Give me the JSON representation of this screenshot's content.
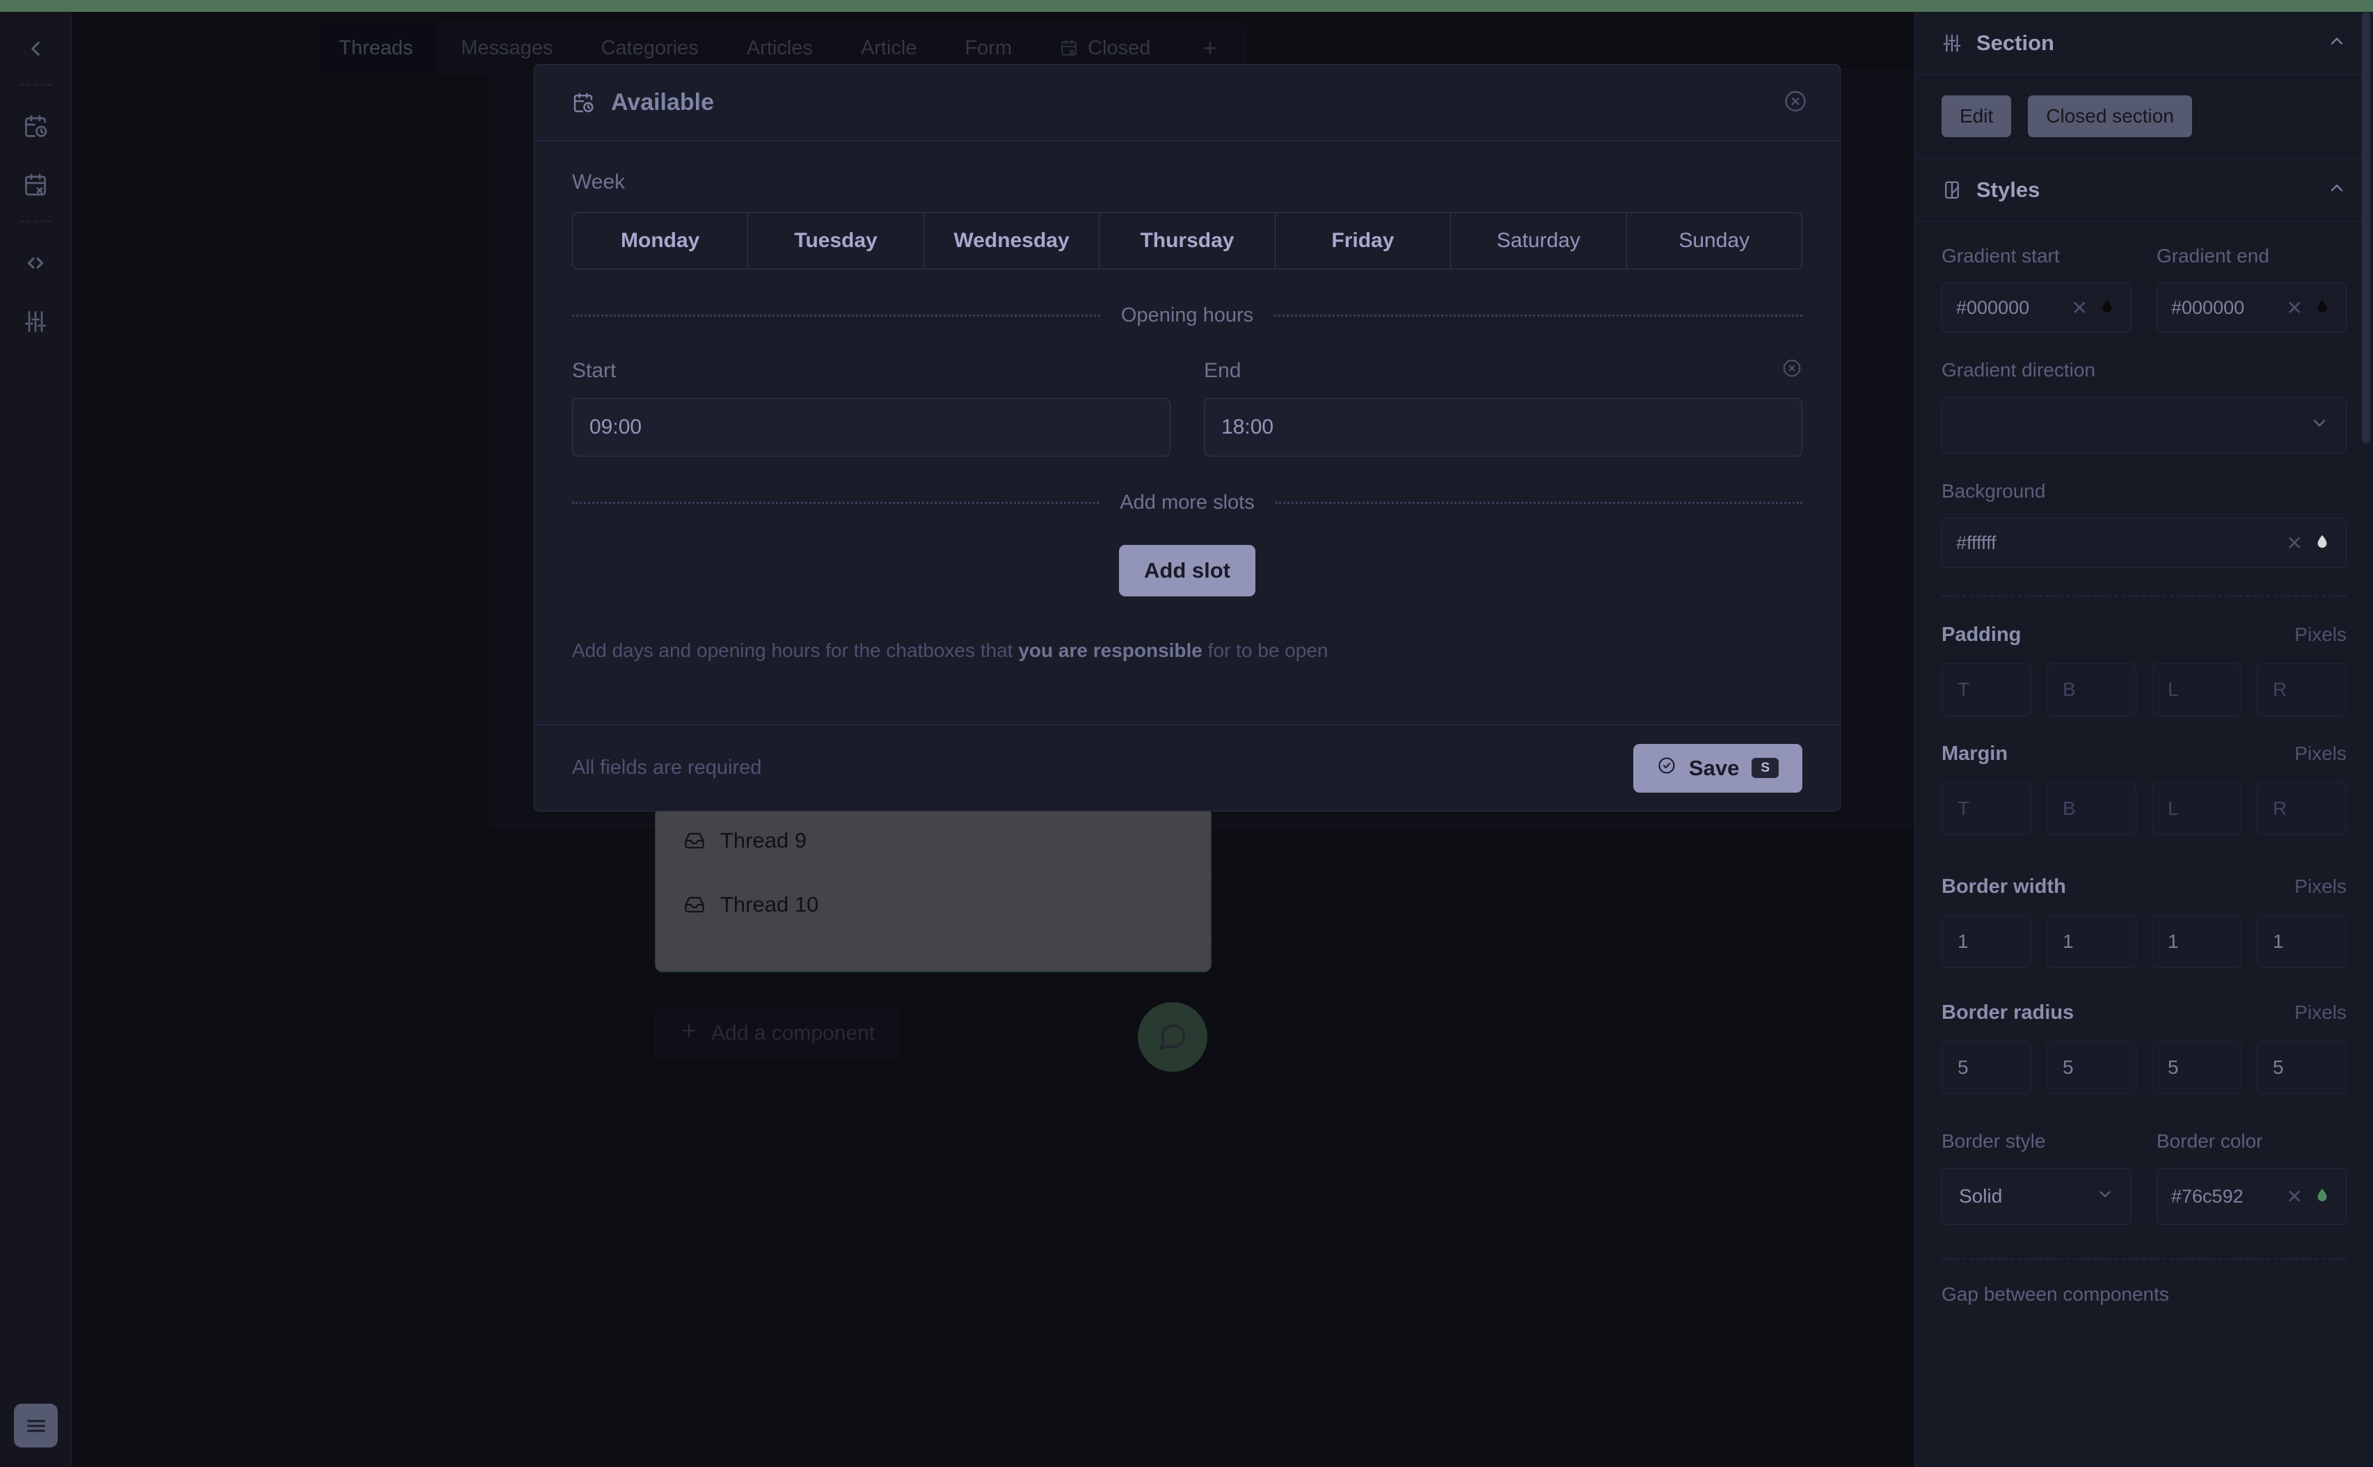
{
  "theme": {
    "accent_green": "#4f7458",
    "panel_bg": "#171925",
    "modal_bg": "#1a1c2a",
    "button_purple": "#9295b8"
  },
  "tabs": [
    {
      "label": "Threads",
      "active": true,
      "icon": ""
    },
    {
      "label": "Messages",
      "active": false,
      "icon": ""
    },
    {
      "label": "Categories",
      "active": false,
      "icon": ""
    },
    {
      "label": "Articles",
      "active": false,
      "icon": ""
    },
    {
      "label": "Article",
      "active": false,
      "icon": ""
    },
    {
      "label": "Form",
      "active": false,
      "icon": ""
    },
    {
      "label": "Closed",
      "active": false,
      "icon": "calendar-x-icon"
    }
  ],
  "tab_add_label": "+",
  "left_rail": {
    "items": [
      {
        "name": "back-chevron-icon"
      },
      {
        "name": "calendar-clock-icon"
      },
      {
        "name": "calendar-x-icon"
      },
      {
        "name": "code-brackets-icon"
      },
      {
        "name": "sliders-icon"
      }
    ],
    "bottom": {
      "name": "hamburger-menu-icon"
    }
  },
  "canvas": {
    "threads": [
      {
        "label": "Thread 9",
        "icon": "inbox-icon"
      },
      {
        "label": "Thread 10",
        "icon": "inbox-icon"
      }
    ],
    "add_component_label": "Add a component",
    "fab_icon": "chat-bubble-icon"
  },
  "modal": {
    "title": "Available",
    "title_icon": "calendar-clock-icon",
    "close_icon": "close-circle-icon",
    "week_label": "Week",
    "days": [
      {
        "label": "Monday",
        "selected": true
      },
      {
        "label": "Tuesday",
        "selected": true
      },
      {
        "label": "Wednesday",
        "selected": true
      },
      {
        "label": "Thursday",
        "selected": true
      },
      {
        "label": "Friday",
        "selected": true
      },
      {
        "label": "Saturday",
        "selected": false
      },
      {
        "label": "Sunday",
        "selected": false
      }
    ],
    "opening_hours_divider": "Opening hours",
    "slot": {
      "start_label": "Start",
      "end_label": "End",
      "start_value": "09:00",
      "end_value": "18:00",
      "remove_icon": "remove-slot-icon"
    },
    "add_more_divider": "Add more slots",
    "add_slot_label": "Add slot",
    "helper_prefix": "Add days and opening hours for the chatboxes that ",
    "helper_bold": "you are responsible",
    "helper_suffix": " for to be open",
    "footer_note": "All fields are required",
    "save_label": "Save",
    "save_shortcut": "S",
    "save_icon": "check-circle-icon"
  },
  "right_panel": {
    "section": {
      "title": "Section",
      "icon": "sliders-icon",
      "chevron": "chevron-up-icon",
      "buttons": [
        {
          "label": "Edit"
        },
        {
          "label": "Closed section"
        }
      ]
    },
    "styles": {
      "title": "Styles",
      "icon": "palette-icon",
      "chevron": "chevron-up-icon",
      "gradient_start_label": "Gradient start",
      "gradient_start_value": "#000000",
      "gradient_end_label": "Gradient end",
      "gradient_end_value": "#000000",
      "gradient_direction_label": "Gradient direction",
      "gradient_direction_value": "",
      "background_label": "Background",
      "background_value": "#ffffff",
      "padding_label": "Padding",
      "padding_unit": "Pixels",
      "padding_values": [
        "T",
        "B",
        "L",
        "R"
      ],
      "margin_label": "Margin",
      "margin_unit": "Pixels",
      "margin_values": [
        "T",
        "B",
        "L",
        "R"
      ],
      "border_width_label": "Border width",
      "border_width_unit": "Pixels",
      "border_width_values": [
        "1",
        "1",
        "1",
        "1"
      ],
      "border_radius_label": "Border radius",
      "border_radius_unit": "Pixels",
      "border_radius_values": [
        "5",
        "5",
        "5",
        "5"
      ],
      "border_style_label": "Border style",
      "border_style_value": "Solid",
      "border_color_label": "Border color",
      "border_color_value": "#76c592",
      "gap_label": "Gap between components"
    }
  }
}
